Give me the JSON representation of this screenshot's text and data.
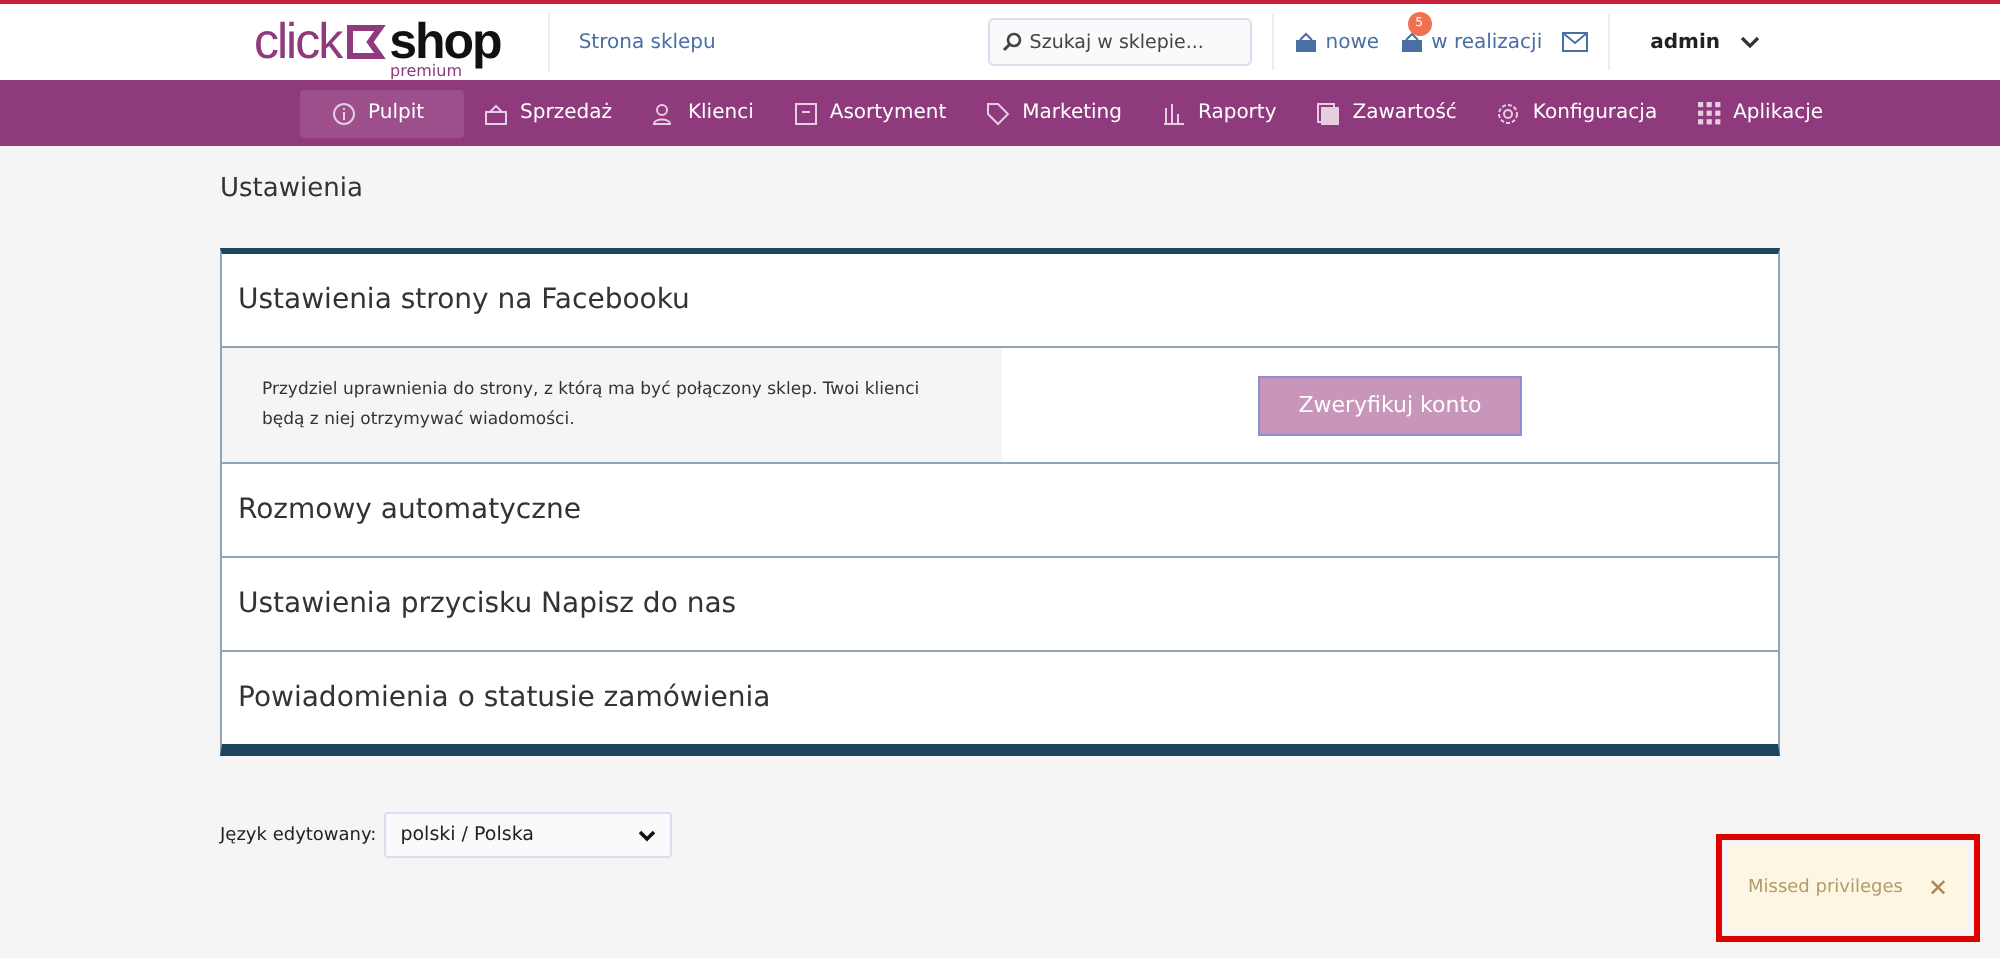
{
  "header": {
    "logo": {
      "word_1": "click",
      "word_2": "shop",
      "tagline": "premium"
    },
    "store_link": "Strona sklepu",
    "search": {
      "placeholder": "Szukaj w sklepie..."
    },
    "orders": [
      {
        "label": "nowe"
      },
      {
        "label": "w realizacji",
        "badge": "5"
      }
    ],
    "user": "admin"
  },
  "nav": [
    {
      "label": "Pulpit",
      "selected": true
    },
    {
      "label": "Sprzedaż",
      "selected": false
    },
    {
      "label": "Klienci",
      "selected": false
    },
    {
      "label": "Asortyment",
      "selected": false
    },
    {
      "label": "Marketing",
      "selected": false
    },
    {
      "label": "Raporty",
      "selected": false
    },
    {
      "label": "Zawartość",
      "selected": false
    },
    {
      "label": "Konfiguracja",
      "selected": false
    },
    {
      "label": "Aplikacje",
      "selected": false
    }
  ],
  "page_title": "Ustawienia",
  "sections": [
    {
      "title": "Ustawienia strony na Facebooku",
      "expanded": true,
      "description": "Przydziel uprawnienia do strony, z którą ma być połączony sklep. Twoi klienci będą z niej otrzymywać wiadomości.",
      "button": "Zweryfikuj konto"
    },
    {
      "title": "Rozmowy automatyczne",
      "expanded": false
    },
    {
      "title": "Ustawienia przycisku Napisz do nas",
      "expanded": false
    },
    {
      "title": "Powiadomienia o statusie zamówienia",
      "expanded": false
    }
  ],
  "language": {
    "label": "Język edytowany:",
    "value": "polski / Polska"
  },
  "toast": {
    "message": "Missed privileges",
    "close": "✕",
    "highlighted": true
  }
}
